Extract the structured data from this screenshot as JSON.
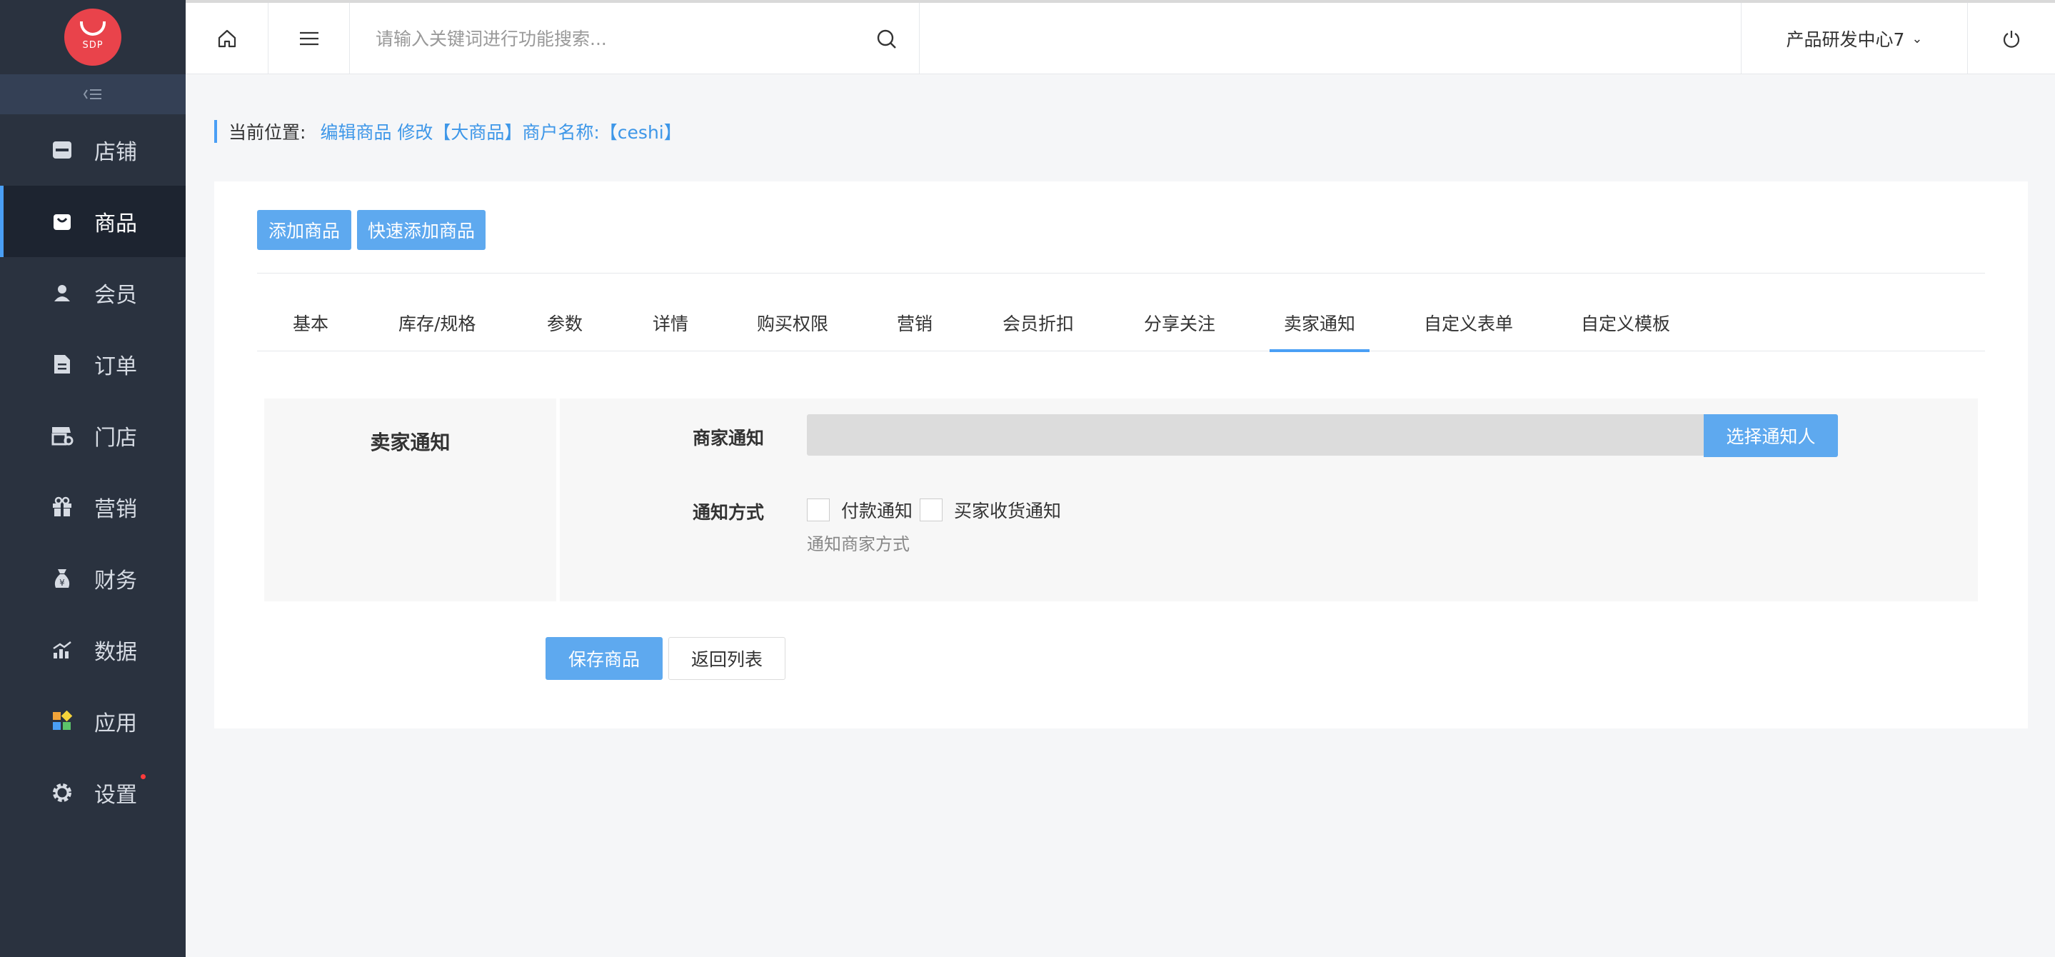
{
  "logo": {
    "text": "SDP"
  },
  "sidebar": {
    "collapse_icon": "collapse-left-icon",
    "items": [
      {
        "label": "店铺",
        "icon": "store-icon",
        "active": false
      },
      {
        "label": "商品",
        "icon": "bag-icon",
        "active": true
      },
      {
        "label": "会员",
        "icon": "user-icon",
        "active": false
      },
      {
        "label": "订单",
        "icon": "document-icon",
        "active": false
      },
      {
        "label": "门店",
        "icon": "shop-settings-icon",
        "active": false
      },
      {
        "label": "营销",
        "icon": "gift-icon",
        "active": false
      },
      {
        "label": "财务",
        "icon": "money-bag-icon",
        "active": false
      },
      {
        "label": "数据",
        "icon": "chart-icon",
        "active": false
      },
      {
        "label": "应用",
        "icon": "apps-icon",
        "active": false
      },
      {
        "label": "设置",
        "icon": "gear-icon",
        "active": false,
        "badge_dot": true
      }
    ]
  },
  "topbar": {
    "search_placeholder": "请输入关键词进行功能搜索...",
    "org_name": "产品研发中心7"
  },
  "breadcrumb": {
    "label": "当前位置:",
    "path": "编辑商品 修改【大商品】商户名称:【ceshi】"
  },
  "actions": {
    "add_product": "添加商品",
    "quick_add": "快速添加商品"
  },
  "tabs": [
    {
      "label": "基本"
    },
    {
      "label": "库存/规格"
    },
    {
      "label": "参数"
    },
    {
      "label": "详情"
    },
    {
      "label": "购买权限"
    },
    {
      "label": "营销"
    },
    {
      "label": "会员折扣"
    },
    {
      "label": "分享关注"
    },
    {
      "label": "卖家通知",
      "active": true
    },
    {
      "label": "自定义表单"
    },
    {
      "label": "自定义模板"
    }
  ],
  "form": {
    "section_title": "卖家通知",
    "merchant_notify_label": "商家通知",
    "select_button": "选择通知人",
    "notify_method_label": "通知方式",
    "options": [
      {
        "label": "付款通知",
        "checked": false
      },
      {
        "label": "买家收货通知",
        "checked": false
      }
    ],
    "hint": "通知商家方式"
  },
  "footer_buttons": {
    "save": "保存商品",
    "back": "返回列表"
  },
  "colors": {
    "sidebar_bg": "#2a323f",
    "accent": "#4a9ff5",
    "button_blue": "#5ea9ef",
    "logo_red": "#e9434b"
  }
}
